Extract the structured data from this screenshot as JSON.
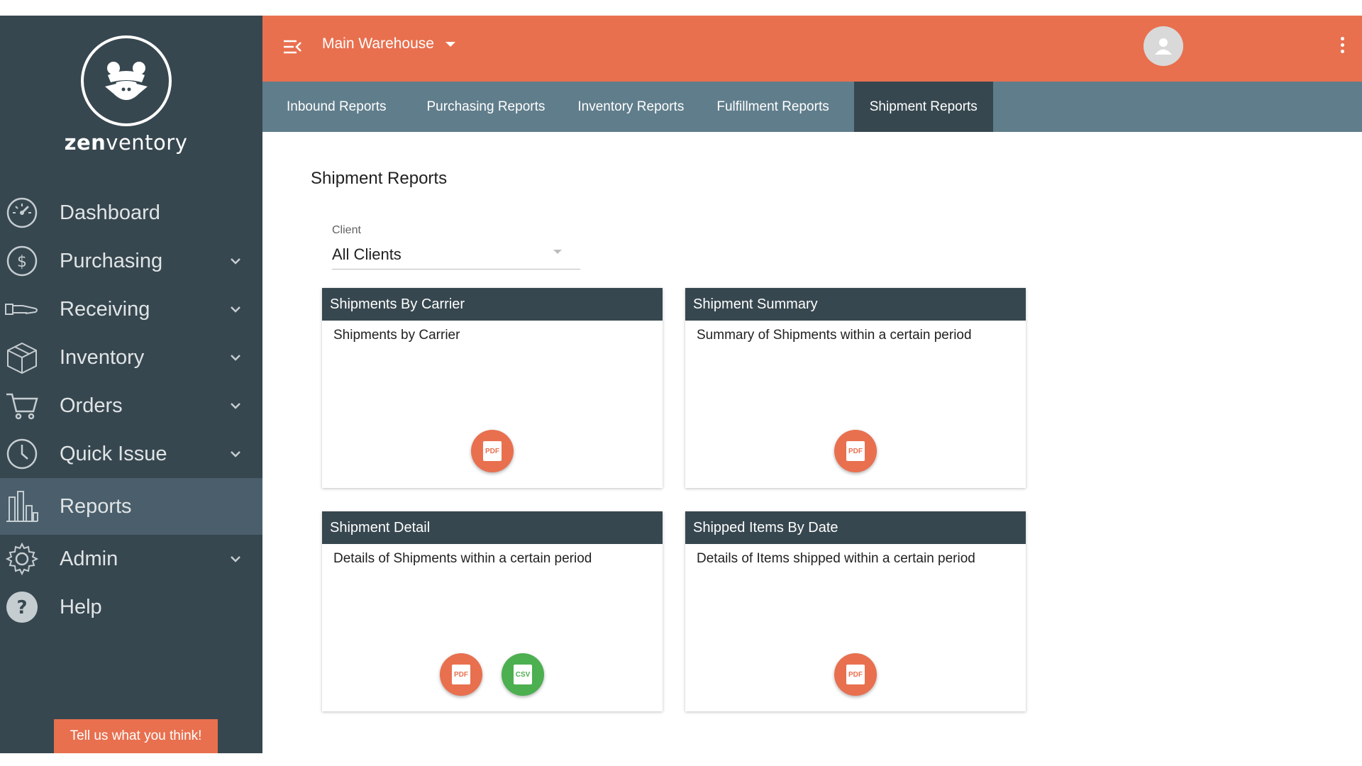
{
  "brand": {
    "logo_prefix": "zen",
    "logo_suffix": "ventory",
    "primary_color": "#e8704f",
    "sidebar_color": "#37474f",
    "tabbar_color": "#607d8b",
    "csv_color": "#4caf50"
  },
  "sidebar": {
    "items": [
      {
        "label": "Dashboard",
        "icon": "speedometer-icon",
        "has_submenu": false
      },
      {
        "label": "Purchasing",
        "icon": "dollar-icon",
        "has_submenu": true
      },
      {
        "label": "Receiving",
        "icon": "hand-icon",
        "has_submenu": true
      },
      {
        "label": "Inventory",
        "icon": "box-icon",
        "has_submenu": true
      },
      {
        "label": "Orders",
        "icon": "cart-icon",
        "has_submenu": true
      },
      {
        "label": "Quick Issue",
        "icon": "clock-icon",
        "has_submenu": true
      },
      {
        "label": "Reports",
        "icon": "bar-chart-icon",
        "has_submenu": false,
        "active": true
      },
      {
        "label": "Admin",
        "icon": "gear-icon",
        "has_submenu": true
      },
      {
        "label": "Help",
        "icon": "help-icon",
        "has_submenu": false
      }
    ],
    "feedback_label": "Tell us what you think!"
  },
  "topbar": {
    "warehouse": "Main Warehouse"
  },
  "tabs": [
    {
      "label": "Inbound Reports",
      "active": false
    },
    {
      "label": "Purchasing Reports",
      "active": false
    },
    {
      "label": "Inventory Reports",
      "active": false
    },
    {
      "label": "Fulfillment Reports",
      "active": false
    },
    {
      "label": "Shipment Reports",
      "active": true
    }
  ],
  "main": {
    "title": "Shipment Reports",
    "client": {
      "label": "Client",
      "value": "All Clients"
    },
    "cards": [
      {
        "title": "Shipments By Carrier",
        "description": "Shipments by Carrier",
        "buttons": [
          "PDF"
        ]
      },
      {
        "title": "Shipment Summary",
        "description": "Summary of Shipments within a certain period",
        "buttons": [
          "PDF"
        ]
      },
      {
        "title": "Shipment Detail",
        "description": "Details of Shipments within a certain period",
        "buttons": [
          "PDF",
          "CSV"
        ]
      },
      {
        "title": "Shipped Items By Date",
        "description": "Details of Items shipped within a certain period",
        "buttons": [
          "PDF"
        ]
      }
    ]
  }
}
